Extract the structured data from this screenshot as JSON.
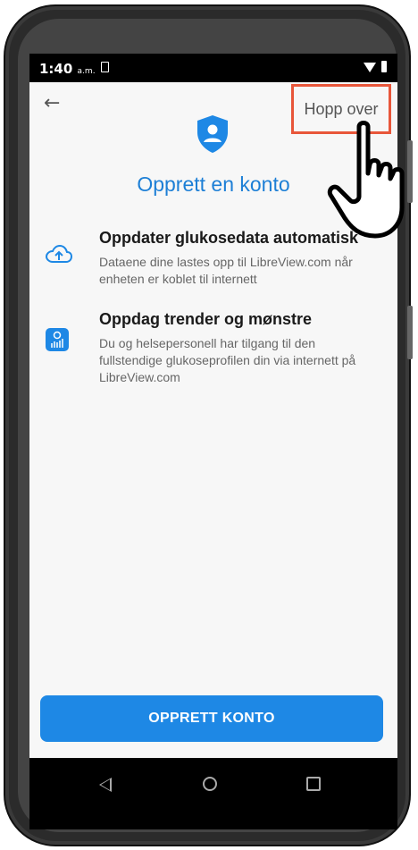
{
  "status": {
    "time": "1:40",
    "ampm": "a.m."
  },
  "header": {
    "skip_label": "Hopp over"
  },
  "title": "Opprett en konto",
  "features": [
    {
      "icon": "cloud-upload-icon",
      "heading": "Oppdater glukosedata automatisk",
      "description": "Dataene dine lastes opp til LibreView.com når enheten er koblet til internett"
    },
    {
      "icon": "trend-chart-icon",
      "heading": "Oppdag trender og mønstre",
      "description": "Du og helsepersonell har tilgang til den fullstendige glukoseprofilen din via internett på LibreView.com"
    }
  ],
  "cta": {
    "label": "OPPRETT KONTO"
  },
  "colors": {
    "accent": "#1e88e5",
    "title": "#1d7fd6",
    "highlight": "#e8563a"
  }
}
